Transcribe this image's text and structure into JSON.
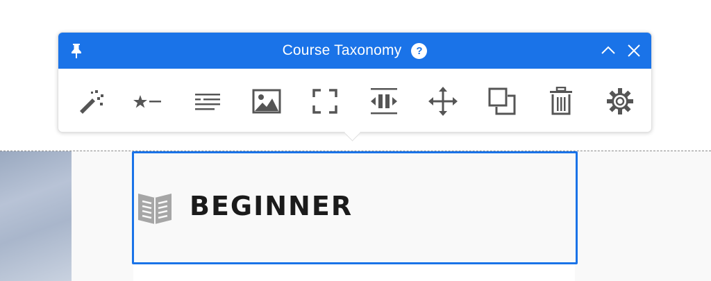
{
  "toolbar": {
    "title": "Course Taxonomy",
    "help_glyph": "?",
    "header_icons": [
      "pin-icon",
      "chevron-up-icon",
      "close-icon"
    ],
    "tools": [
      {
        "name": "magic-wand-icon"
      },
      {
        "name": "star-list-icon"
      },
      {
        "name": "text-lines-icon"
      },
      {
        "name": "image-icon"
      },
      {
        "name": "fullscreen-icon"
      },
      {
        "name": "spacing-icon"
      },
      {
        "name": "move-icon"
      },
      {
        "name": "duplicate-icon"
      },
      {
        "name": "trash-icon"
      },
      {
        "name": "settings-gear-icon"
      }
    ],
    "accent_color": "#1a73e8",
    "icon_color": "#555555"
  },
  "element": {
    "icon": "book-icon",
    "label": "BEGINNER",
    "selection_color": "#1a73e8"
  }
}
